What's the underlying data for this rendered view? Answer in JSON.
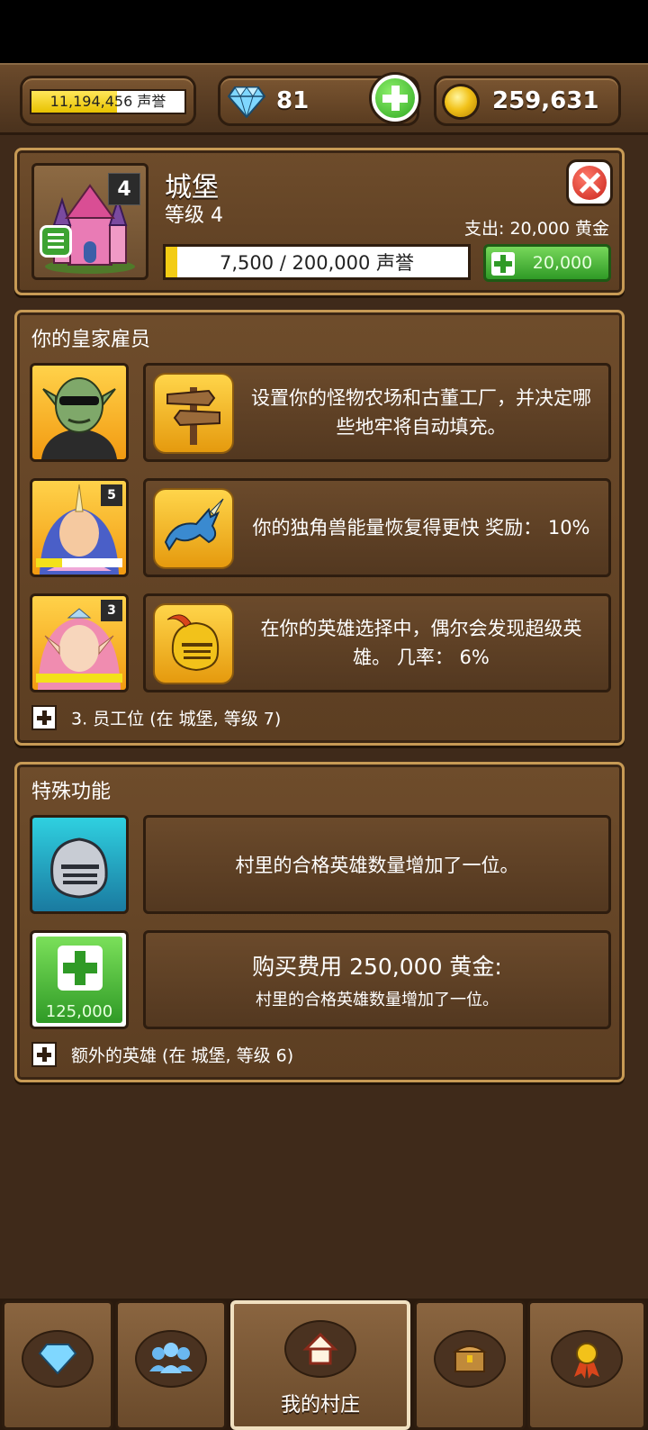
{
  "resources": {
    "reputation_text": "11,194,456 声誉",
    "gems": "81",
    "gold": "259,631"
  },
  "building": {
    "name": "城堡",
    "level_label": "等级 4",
    "level_badge": "4",
    "cost_label": "支出: 20,000 黄金",
    "progress_text": "7,500 / 200,000 声誉",
    "progress_fraction": 0.0375,
    "upgrade_price": "20,000"
  },
  "employees": {
    "title": "你的皇家雇员",
    "items": [
      {
        "rank": "",
        "icon": "signpost-icon",
        "text": "设置你的怪物农场和古董工厂，并决定哪些地牢将自动填充。"
      },
      {
        "rank": "5",
        "icon": "unicorn-icon",
        "text": "你的独角兽能量恢复得更快 奖励： 10%"
      },
      {
        "rank": "3",
        "icon": "golden-helmet-icon",
        "text": "在你的英雄选择中，偶尔会发现超级英雄。 几率： 6%"
      }
    ],
    "slot_hint": "3. 员工位 (在 城堡, 等级 7)"
  },
  "special": {
    "title": "特殊功能",
    "feature1_text": "村里的合格英雄数量增加了一位。",
    "buy_price_badge": "125,000",
    "feature2_title": "购买费用 250,000 黄金:",
    "feature2_sub": "村里的合格英雄数量增加了一位。",
    "extra_hint": "额外的英雄 (在 城堡, 等级 6)"
  },
  "nav": {
    "items": [
      {
        "icon": "gem-shop-icon",
        "label": ""
      },
      {
        "icon": "heroes-group-icon",
        "label": ""
      },
      {
        "icon": "home-icon",
        "label": "我的村庄",
        "active": true
      },
      {
        "icon": "treasure-chest-icon",
        "label": ""
      },
      {
        "icon": "medal-icon",
        "label": ""
      }
    ]
  },
  "colors": {
    "panel_border": "#c79a55",
    "wood_dark": "#3f2a1a",
    "accent_green": "#2f9a26",
    "accent_yellow": "#f3cc14"
  }
}
